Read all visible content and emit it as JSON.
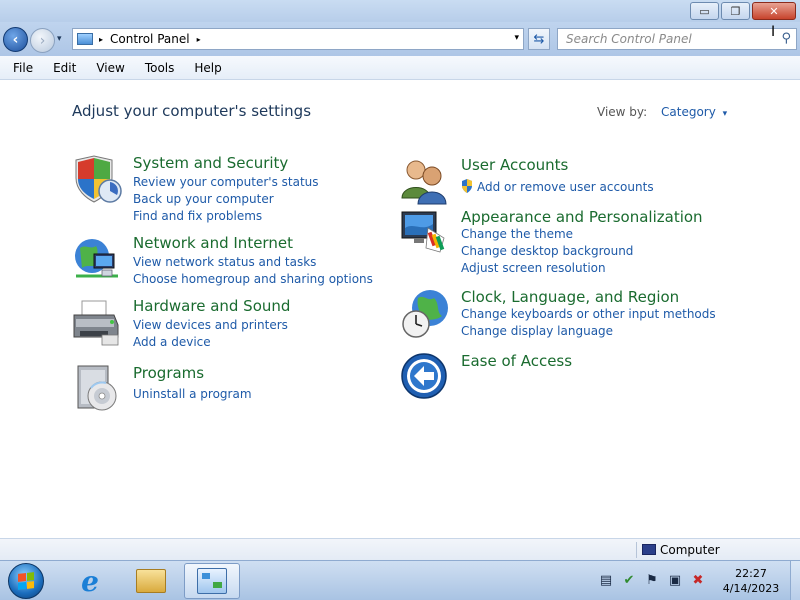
{
  "window": {
    "controls": {
      "minimize": "▭",
      "maximize": "❐",
      "close": "✕"
    }
  },
  "nav": {
    "back": "‹",
    "forward": "›",
    "history": "▾",
    "breadcrumb": "Control Panel",
    "breadcrumb_arrow": "▸",
    "dropdown": "▾",
    "refresh": "⇆",
    "search_placeholder": "Search Control Panel",
    "search_icon": "⚲"
  },
  "menu": [
    "File",
    "Edit",
    "View",
    "Tools",
    "Help"
  ],
  "content": {
    "heading": "Adjust your computer's settings",
    "view_by_label": "View by:",
    "view_by_value": "Category",
    "view_by_caret": "▾"
  },
  "categories": [
    {
      "title": "System and Security",
      "icon": "shield-icon",
      "links": [
        "Review your computer's status",
        "Back up your computer",
        "Find and fix problems"
      ]
    },
    {
      "title": "Network and Internet",
      "icon": "network-icon",
      "links": [
        "View network status and tasks",
        "Choose homegroup and sharing options"
      ]
    },
    {
      "title": "Hardware and Sound",
      "icon": "printer-icon",
      "links": [
        "View devices and printers",
        "Add a device"
      ]
    },
    {
      "title": "Programs",
      "icon": "programs-icon",
      "links": [
        "Uninstall a program"
      ]
    },
    {
      "title": "User Accounts",
      "icon": "users-icon",
      "links": [
        "Add or remove user accounts"
      ]
    },
    {
      "title": "Appearance and Personalization",
      "icon": "monitor-palette-icon",
      "links": [
        "Change the theme",
        "Change desktop background",
        "Adjust screen resolution"
      ]
    },
    {
      "title": "Clock, Language, and Region",
      "icon": "globe-clock-icon",
      "links": [
        "Change keyboards or other input methods",
        "Change display language"
      ]
    },
    {
      "title": "Ease of Access",
      "icon": "ease-of-access-icon",
      "links": []
    }
  ],
  "status": {
    "location": "Computer"
  },
  "taskbar": {
    "clock_time": "22:27",
    "clock_date": "4/14/2023",
    "tray": {
      "notes": "▤",
      "security": "✔",
      "flag": "⚑",
      "network": "▣",
      "volume": "✖"
    }
  },
  "colors": {
    "link": "#1e5aa8",
    "category_title": "#1a6b2f",
    "heading": "#1e395b"
  }
}
